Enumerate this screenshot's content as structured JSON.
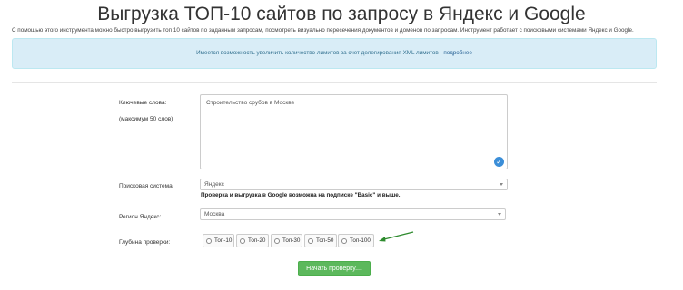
{
  "page": {
    "title": "Выгрузка ТОП-10 сайтов по запросу в Яндекс и Google",
    "subtitle": "С помощью этого инструмента можно быстро выгрузить топ 10 сайтов по заданным запросам, посмотреть визуально пересечения документов и доменов по запросам. Инструмент работает с поисковыми системами Яндекс и Google."
  },
  "info": {
    "text": "Имеется возможность увеличить количество лимитов за счет делегирования XML лимитов -",
    "link": "подробнее"
  },
  "form": {
    "keywords_label": "Ключевые слова:",
    "keywords_hint": "(максимум 50 слов)",
    "keywords_value": "Строительство срубов в Москве",
    "engine_label": "Поисковая система:",
    "engine_value": "Яндекс",
    "engine_note": "Проверка и выгрузка в Google возможна на подписке \"Basic\" и выше.",
    "region_label": "Регион Яндекс:",
    "region_value": "Москва",
    "depth_label": "Глубина проверки:",
    "depth_options": [
      "Топ-10",
      "Топ-20",
      "Топ-30",
      "Топ-50",
      "Топ-100"
    ],
    "submit_label": "Начать проверку...."
  },
  "colors": {
    "info_bg": "#d9edf7",
    "button": "#5cb85c",
    "arrow": "#2e8b2e",
    "check": "#3b8ed8"
  }
}
